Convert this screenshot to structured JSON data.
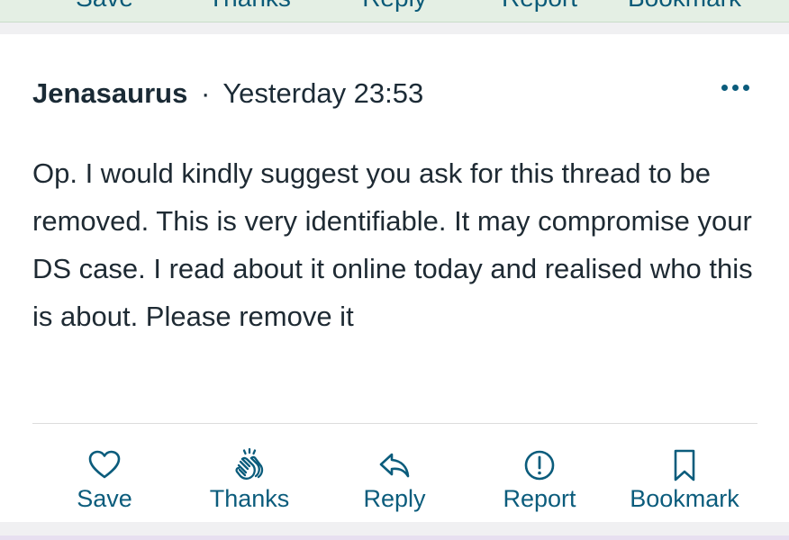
{
  "previous_post_actions": [
    "Save",
    "Thanks",
    "Reply",
    "Report",
    "Bookmark"
  ],
  "post": {
    "author": "Jenasaurus",
    "separator": "·",
    "timestamp": "Yesterday 23:53",
    "body": "Op. I would kindly suggest you ask for this thread to be removed. This is very identifiable. It may compromise your DS case. I read about it online today and realised who this is about. Please remove it",
    "actions": [
      {
        "label": "Save",
        "icon": "heart-icon"
      },
      {
        "label": "Thanks",
        "icon": "clapping-hands-icon"
      },
      {
        "label": "Reply",
        "icon": "reply-arrow-icon"
      },
      {
        "label": "Report",
        "icon": "exclamation-circle-icon"
      },
      {
        "label": "Bookmark",
        "icon": "bookmark-icon"
      }
    ]
  },
  "colors": {
    "accent": "#0b5c7c",
    "text": "#1e2a33",
    "background": "#ffffff"
  }
}
